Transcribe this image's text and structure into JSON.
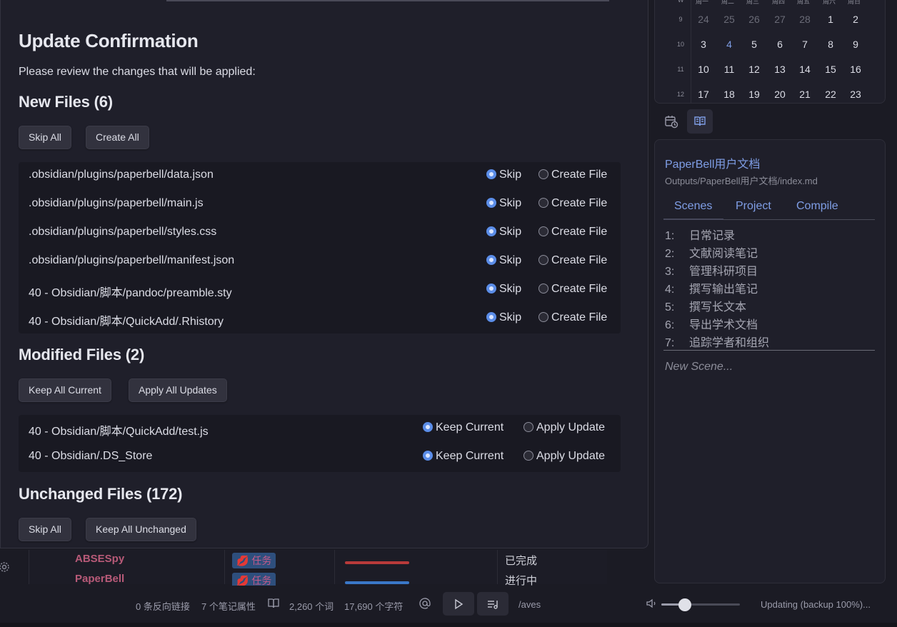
{
  "modal": {
    "title": "Update Confirmation",
    "intro": "Please review the changes that will be applied:",
    "new_files": {
      "heading": "New Files (6)",
      "skip_all_label": "Skip All",
      "create_all_label": "Create All",
      "option_a": "Skip",
      "option_b": "Create File",
      "files": [
        ".obsidian/plugins/paperbell/data.json",
        ".obsidian/plugins/paperbell/main.js",
        ".obsidian/plugins/paperbell/styles.css",
        ".obsidian/plugins/paperbell/manifest.json",
        "40 - Obsidian/脚本/pandoc/preamble.sty",
        "40 - Obsidian/脚本/QuickAdd/.Rhistory"
      ]
    },
    "modified_files": {
      "heading": "Modified Files (2)",
      "keep_all_label": "Keep All Current",
      "apply_all_label": "Apply All Updates",
      "option_a": "Keep Current",
      "option_b": "Apply Update",
      "files": [
        "40 - Obsidian/脚本/QuickAdd/test.js",
        "40 - Obsidian/.DS_Store"
      ]
    },
    "unchanged_files": {
      "heading": "Unchanged Files (172)",
      "skip_all_label": "Skip All",
      "keep_all_label": "Keep All Unchanged"
    }
  },
  "background_table": {
    "rows": [
      {
        "name": "ABSESpy",
        "tag": "任务",
        "status": "已完成",
        "bar_color": "#b83a3a"
      },
      {
        "name": "PaperBell",
        "tag": "任务",
        "status": "进行中",
        "bar_color": "#3a78c8"
      }
    ]
  },
  "calendar": {
    "headers": [
      "W",
      "周一",
      "周二",
      "周三",
      "周四",
      "周五",
      "周六",
      "周日"
    ],
    "weeks": [
      {
        "week": "9",
        "days": [
          "24",
          "25",
          "26",
          "27",
          "28",
          "1",
          "2"
        ]
      },
      {
        "week": "10",
        "days": [
          "3",
          "4",
          "5",
          "6",
          "7",
          "8",
          "9"
        ]
      },
      {
        "week": "11",
        "days": [
          "10",
          "11",
          "12",
          "13",
          "14",
          "15",
          "16"
        ]
      },
      {
        "week": "12",
        "days": [
          "17",
          "18",
          "19",
          "20",
          "21",
          "22",
          "23"
        ]
      }
    ],
    "today": "4"
  },
  "doc_panel": {
    "title": "PaperBell用户文档",
    "path": "Outputs/PaperBell用户文档/index.md",
    "tabs": [
      "Scenes",
      "Project",
      "Compile"
    ],
    "scenes": [
      {
        "num": "1:",
        "label": "日常记录"
      },
      {
        "num": "2:",
        "label": "文献阅读笔记"
      },
      {
        "num": "3:",
        "label": "管理科研项目"
      },
      {
        "num": "4:",
        "label": "撰写输出笔记"
      },
      {
        "num": "5:",
        "label": "撰写长文本"
      },
      {
        "num": "6:",
        "label": "导出学术文档"
      },
      {
        "num": "7:",
        "label": "追踪学者和组织"
      }
    ],
    "new_scene_placeholder": "New Scene..."
  },
  "statusbar": {
    "backlinks": "0 条反向链接",
    "properties": "7 个笔记属性",
    "words": "2,260 个词",
    "chars": "17,690 个字符",
    "waves": "/aves",
    "volume_level": 0.3,
    "sync": "Updating (backup 100%)..."
  },
  "colors": {
    "accent": "#7f9ee6",
    "radio_on": "#5b8de8",
    "modal_bg": "#1f1f2a",
    "list_bg": "#191922"
  }
}
